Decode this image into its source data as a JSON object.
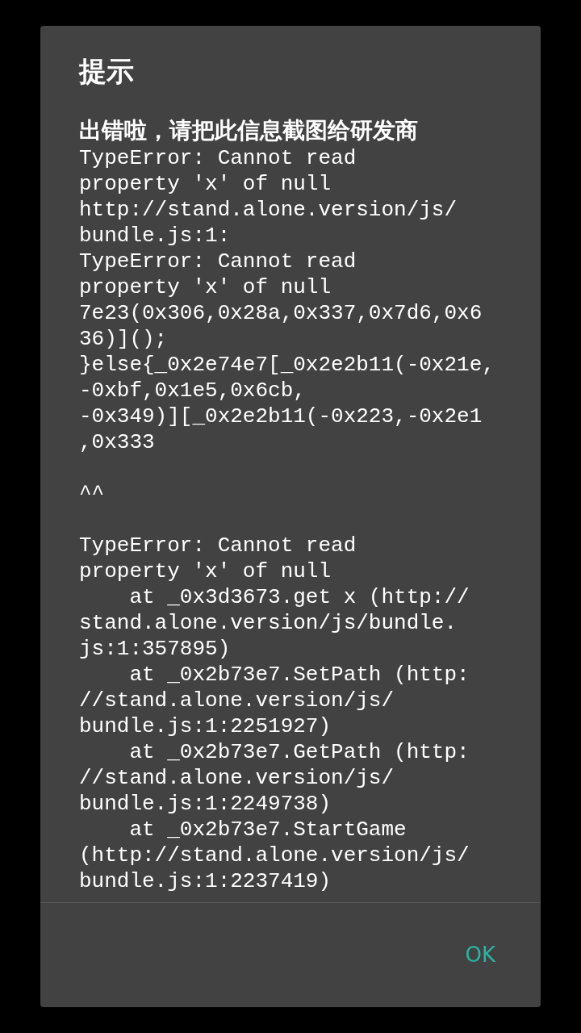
{
  "dialog": {
    "title": "提示",
    "subtitle": "出错啦，请把此信息截图给研发商",
    "message_blocks": [
      [
        "TypeError: Cannot read",
        "property 'x' of null",
        "http://stand.alone.version/js/",
        "bundle.js:1:",
        "TypeError: Cannot read",
        "property 'x' of null",
        "7e23(0x306,0x28a,0x337,0x7d6,0x6",
        "36)]();",
        "}else{_0x2e74e7[_0x2e2b11(-0x21e,",
        "-0xbf,0x1e5,0x6cb,",
        "-0x349)][_0x2e2b11(-0x223,-0x2e1",
        ",0x333"
      ],
      [
        "^^"
      ],
      [
        "TypeError: Cannot read",
        "property 'x' of null",
        "    at _0x3d3673.get x (http://",
        "stand.alone.version/js/bundle.",
        "js:1:357895)",
        "    at _0x2b73e7.SetPath (http:",
        "//stand.alone.version/js/",
        "bundle.js:1:2251927)",
        "    at _0x2b73e7.GetPath (http:",
        "//stand.alone.version/js/",
        "bundle.js:1:2249738)",
        "    at _0x2b73e7.StartGame",
        "(http://stand.alone.version/js/",
        "bundle.js:1:2237419)"
      ]
    ],
    "buttons": [
      "OK"
    ]
  }
}
